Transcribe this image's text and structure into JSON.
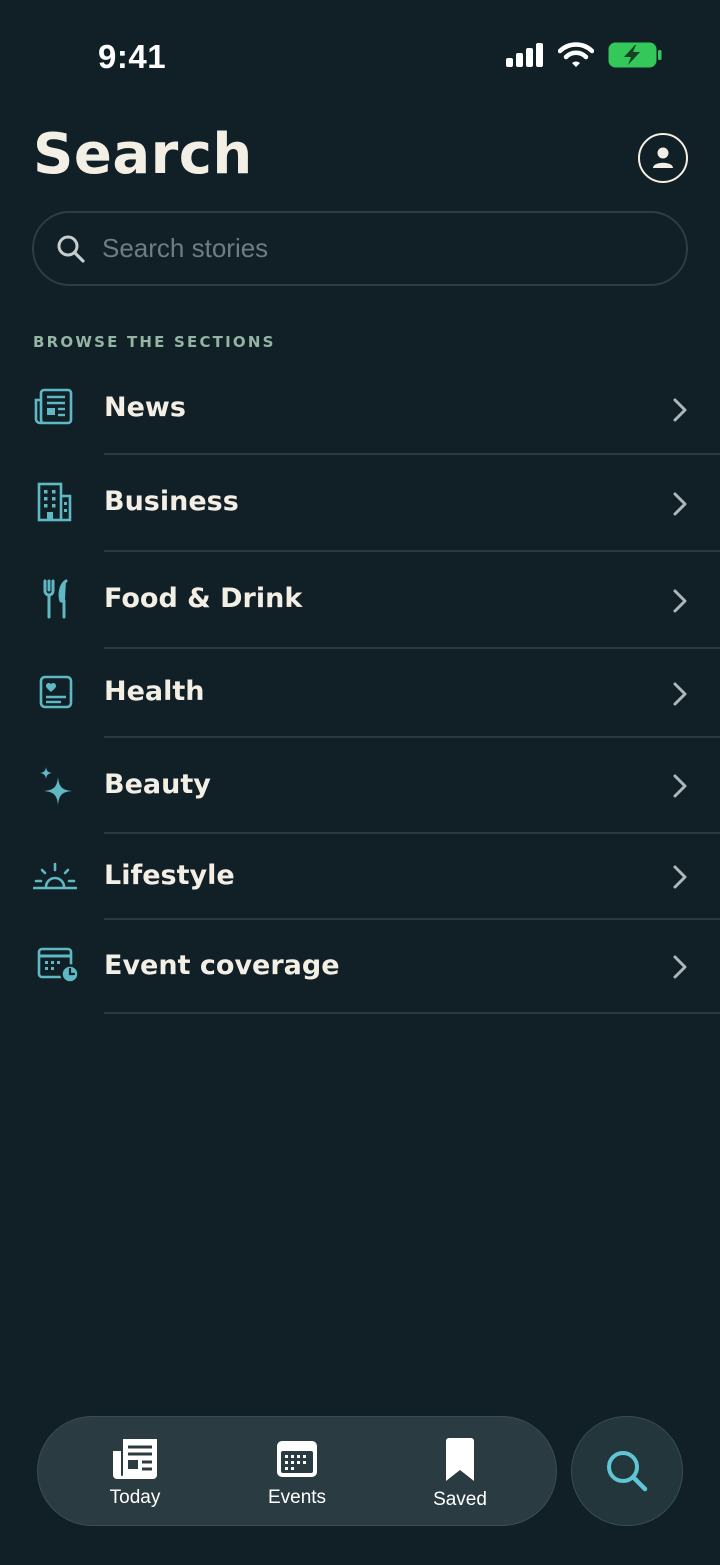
{
  "status_bar": {
    "time": "9:41"
  },
  "header": {
    "title": "Search"
  },
  "search": {
    "placeholder": "Search stories"
  },
  "sections": {
    "label": "BROWSE THE SECTIONS",
    "items": [
      {
        "label": "News",
        "icon": "newspaper-icon"
      },
      {
        "label": "Business",
        "icon": "building-icon"
      },
      {
        "label": "Food & Drink",
        "icon": "fork-knife-icon"
      },
      {
        "label": "Health",
        "icon": "health-card-icon"
      },
      {
        "label": "Beauty",
        "icon": "sparkle-icon"
      },
      {
        "label": "Lifestyle",
        "icon": "sunrise-icon"
      },
      {
        "label": "Event coverage",
        "icon": "calendar-clock-icon"
      }
    ]
  },
  "tab_bar": {
    "tabs": [
      {
        "label": "Today",
        "icon": "newspaper-icon"
      },
      {
        "label": "Events",
        "icon": "calendar-icon"
      },
      {
        "label": "Saved",
        "icon": "bookmark-icon"
      }
    ],
    "fab_icon": "search-icon"
  },
  "colors": {
    "background": "#111f26",
    "accent": "#5fb9c4",
    "text": "#f3efe4",
    "section_label": "#93b5a3",
    "tab_bar": "#2b3b42",
    "battery": "#34c759"
  }
}
